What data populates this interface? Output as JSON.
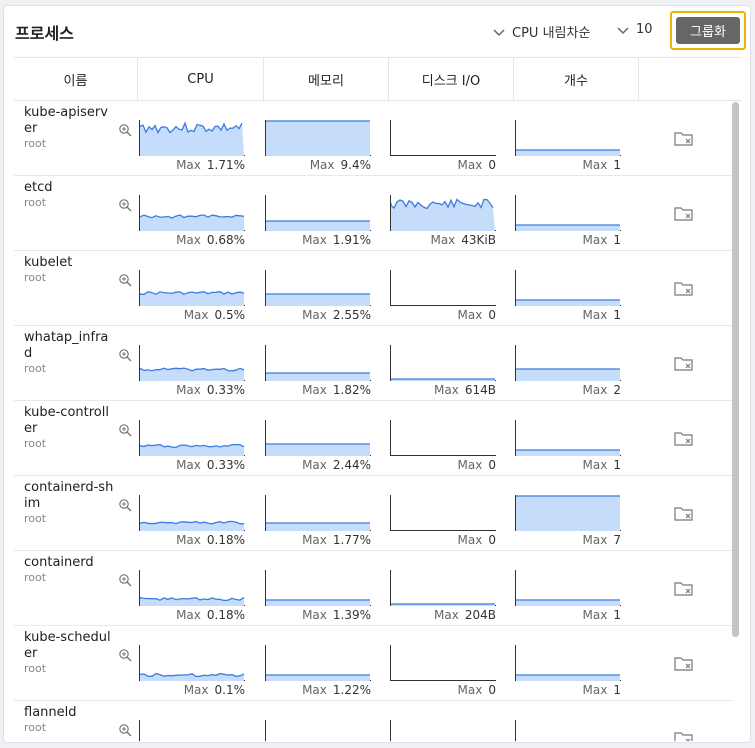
{
  "header": {
    "title": "프로세스",
    "sort_label": "CPU 내림차순",
    "limit_label": "10",
    "group_button": "그룹화"
  },
  "columns": [
    "이름",
    "CPU",
    "메모리",
    "디스크 I/O",
    "개수"
  ],
  "max_label": "Max",
  "colors": {
    "spark_fill": "#c6dcfb",
    "spark_line": "#3d7be0",
    "highlight": "#f0b400"
  },
  "rows": [
    {
      "name": "kube-apiserver",
      "user": "root",
      "cpu": "1.71%",
      "mem": "9.4%",
      "disk": "0",
      "count": "1"
    },
    {
      "name": "etcd",
      "user": "root",
      "cpu": "0.68%",
      "mem": "1.91%",
      "disk": "43KiB",
      "count": "1"
    },
    {
      "name": "kubelet",
      "user": "root",
      "cpu": "0.5%",
      "mem": "2.55%",
      "disk": "0",
      "count": "1"
    },
    {
      "name": "whatap_infrad",
      "user": "root",
      "cpu": "0.33%",
      "mem": "1.82%",
      "disk": "614B",
      "count": "2"
    },
    {
      "name": "kube-controller",
      "user": "root",
      "cpu": "0.33%",
      "mem": "2.44%",
      "disk": "0",
      "count": "1"
    },
    {
      "name": "containerd-shim",
      "user": "root",
      "cpu": "0.18%",
      "mem": "1.77%",
      "disk": "0",
      "count": "7"
    },
    {
      "name": "containerd",
      "user": "root",
      "cpu": "0.18%",
      "mem": "1.39%",
      "disk": "204B",
      "count": "1"
    },
    {
      "name": "kube-scheduler",
      "user": "root",
      "cpu": "0.1%",
      "mem": "1.22%",
      "disk": "0",
      "count": "1"
    },
    {
      "name": "flanneld",
      "user": "root",
      "cpu": "",
      "mem": "",
      "disk": "",
      "count": ""
    }
  ]
}
